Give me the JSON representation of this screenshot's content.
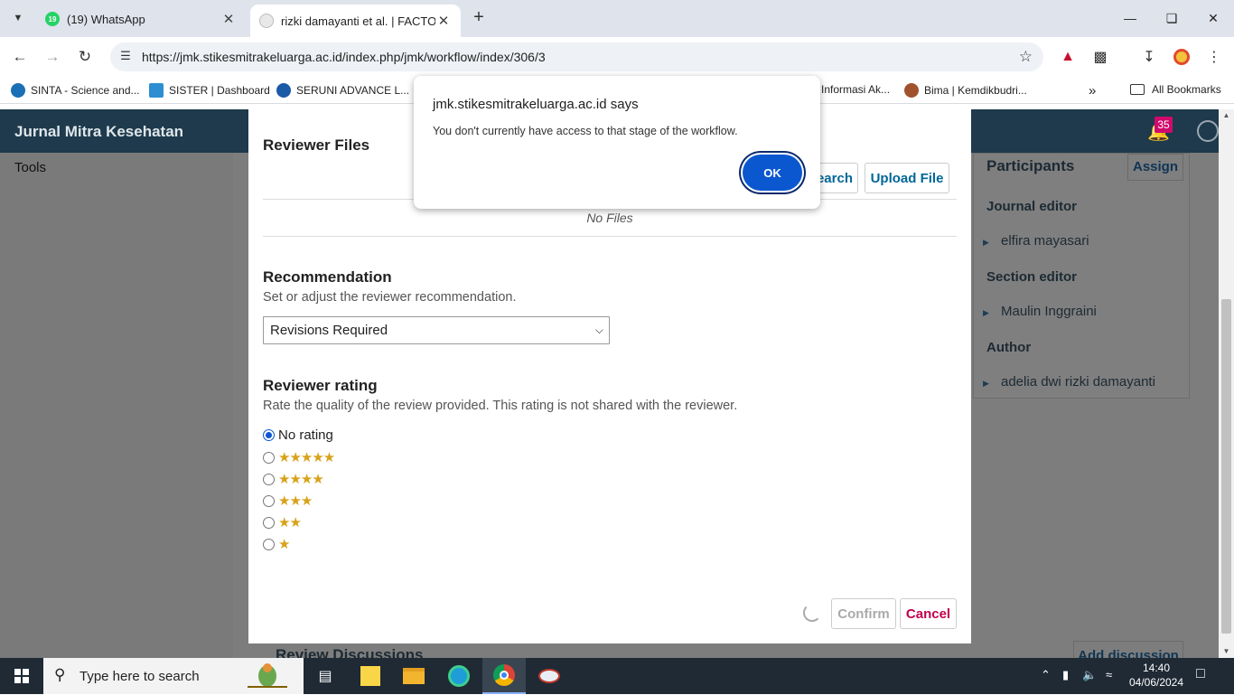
{
  "browser": {
    "tabs": [
      {
        "title": "(19) WhatsApp",
        "badge": "19"
      },
      {
        "title": "rizki damayanti et al. | FACTORS"
      }
    ],
    "url": "https://jmk.stikesmitrakeluarga.ac.id/index.php/jmk/workflow/index/306/3",
    "bookmarks": [
      {
        "label": "SINTA - Science and..."
      },
      {
        "label": "SISTER | Dashboard"
      },
      {
        "label": "SERUNI ADVANCE L..."
      },
      {
        "label": "Informasi Ak..."
      },
      {
        "label": "Bima | Kemdikbudri..."
      }
    ],
    "all_bookmarks": "All Bookmarks"
  },
  "site": {
    "title": "Jurnal Mitra Kesehatan",
    "notification_count": "35"
  },
  "left_nav": {
    "tools": "Tools"
  },
  "participants": {
    "title": "Participants",
    "assign_label": "Assign",
    "groups": [
      {
        "role": "Journal editor",
        "names": [
          "elfira mayasari"
        ]
      },
      {
        "role": "Section editor",
        "names": [
          "Maulin Inggraini"
        ]
      },
      {
        "role": "Author",
        "names": [
          "adelia dwi rizki damayanti"
        ]
      }
    ]
  },
  "modal": {
    "reviewer_files_title": "Reviewer Files",
    "search_label": "earch",
    "upload_label": "Upload File",
    "no_files": "No Files",
    "recommendation_title": "Recommendation",
    "recommendation_desc": "Set or adjust the reviewer recommendation.",
    "recommendation_value": "Revisions Required",
    "rating_title": "Reviewer rating",
    "rating_desc": "Rate the quality of the review provided. This rating is not shared with the reviewer.",
    "rating_options": [
      {
        "label": "No rating",
        "stars": 0,
        "selected": true
      },
      {
        "stars": 5,
        "glyphs": "★★★★★"
      },
      {
        "stars": 4,
        "glyphs": "★★★★"
      },
      {
        "stars": 3,
        "glyphs": "★★★"
      },
      {
        "stars": 2,
        "glyphs": "★★"
      },
      {
        "stars": 1,
        "glyphs": "★"
      }
    ],
    "confirm_label": "Confirm",
    "cancel_label": "Cancel"
  },
  "behind": {
    "review_discussions": "Review Discussions",
    "add_discussion": "Add discussion"
  },
  "alert": {
    "title": "jmk.stikesmitrakeluarga.ac.id says",
    "message": "You don't currently have access to that stage of the workflow.",
    "ok_label": "OK"
  },
  "taskbar": {
    "search_placeholder": "Type here to search",
    "time": "14:40",
    "date": "04/06/2024"
  },
  "colors": {
    "header": "#1e3a4c",
    "link": "#006798",
    "cancel": "#c0004e",
    "star": "#d8a21a",
    "ok_button": "#0b57d0"
  }
}
